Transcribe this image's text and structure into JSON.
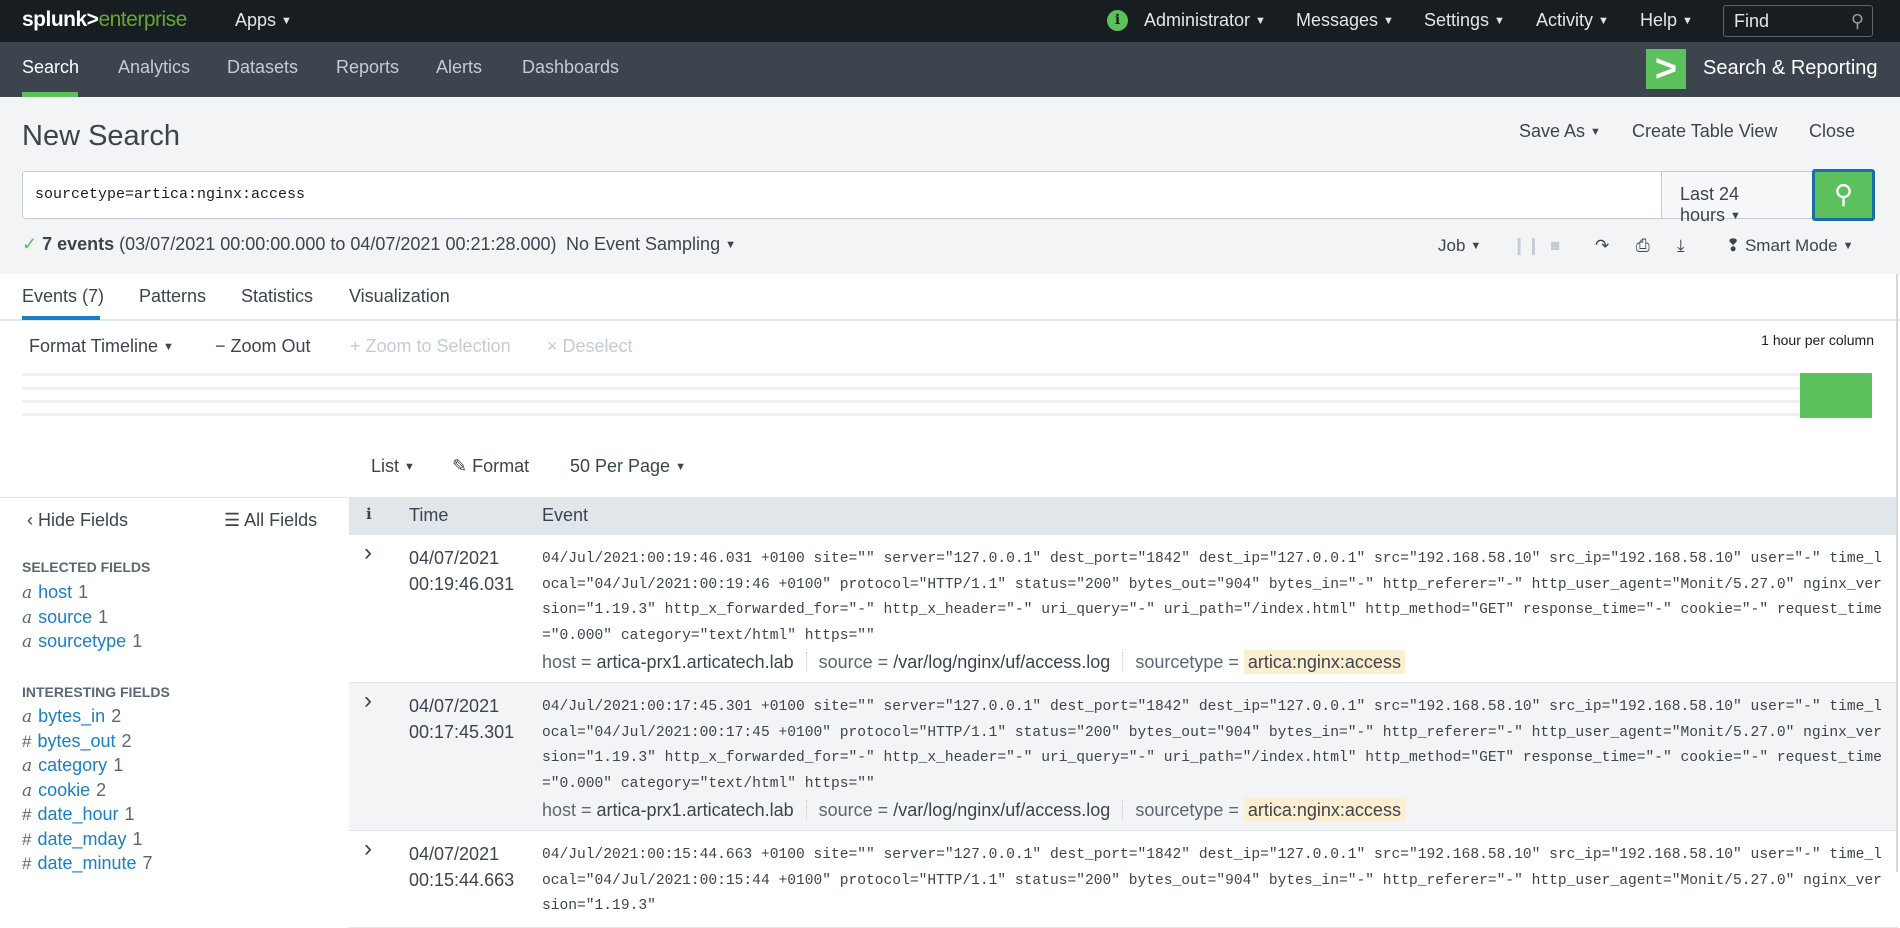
{
  "topbar": {
    "logo_a": "splunk>",
    "logo_b": "enterprise",
    "apps": "Apps",
    "info_icon": "i",
    "menus": [
      "Administrator",
      "Messages",
      "Settings",
      "Activity",
      "Help"
    ],
    "find_placeholder": "Find"
  },
  "nav": {
    "items": [
      "Search",
      "Analytics",
      "Datasets",
      "Reports",
      "Alerts",
      "Dashboards"
    ],
    "app_name": "Search & Reporting"
  },
  "header": {
    "title": "New Search",
    "save_as": "Save As",
    "create_table_view": "Create Table View",
    "close": "Close"
  },
  "search": {
    "query": "sourcetype=artica:nginx:access",
    "time_range": "Last 24 hours"
  },
  "status": {
    "count": "7 events",
    "range": "(03/07/2021 00:00:00.000 to 04/07/2021 00:21:28.000)",
    "sampling": "No Event Sampling",
    "job": "Job",
    "mode": "Smart Mode"
  },
  "tabs": [
    "Events (7)",
    "Patterns",
    "Statistics",
    "Visualization"
  ],
  "timeline": {
    "format": "Format Timeline",
    "zoom_out": "Zoom Out",
    "zoom_sel": "Zoom to Selection",
    "deselect": "Deselect",
    "resolution": "1 hour per column"
  },
  "results_bar": {
    "list": "List",
    "format": "Format",
    "per_page": "50 Per Page"
  },
  "sidebar": {
    "hide": "Hide Fields",
    "all": "All Fields",
    "selected_header": "SELECTED FIELDS",
    "interesting_header": "INTERESTING FIELDS",
    "selected": [
      {
        "type": "a",
        "name": "host",
        "count": "1"
      },
      {
        "type": "a",
        "name": "source",
        "count": "1"
      },
      {
        "type": "a",
        "name": "sourcetype",
        "count": "1"
      }
    ],
    "interesting": [
      {
        "type": "a",
        "name": "bytes_in",
        "count": "2"
      },
      {
        "type": "#",
        "name": "bytes_out",
        "count": "2"
      },
      {
        "type": "a",
        "name": "category",
        "count": "1"
      },
      {
        "type": "a",
        "name": "cookie",
        "count": "2"
      },
      {
        "type": "#",
        "name": "date_hour",
        "count": "1"
      },
      {
        "type": "#",
        "name": "date_mday",
        "count": "1"
      },
      {
        "type": "#",
        "name": "date_minute",
        "count": "7"
      }
    ]
  },
  "table": {
    "col_i": "i",
    "col_time": "Time",
    "col_event": "Event",
    "events": [
      {
        "date": "04/07/2021",
        "time": "00:19:46.031",
        "raw": "04/Jul/2021:00:19:46.031 +0100  site=\"\" server=\"127.0.0.1\" dest_port=\"1842\" dest_ip=\"127.0.0.1\" src=\"192.168.58.10\" src_ip=\"192.168.58.10\" user=\"-\" time_local=\"04/Jul/2021:00:19:46 +0100\" protocol=\"HTTP/1.1\" status=\"200\" bytes_out=\"904\" bytes_in=\"-\" http_referer=\"-\" http_user_agent=\"Monit/5.27.0\" nginx_version=\"1.19.3\" http_x_forwarded_for=\"-\" http_x_header=\"-\" uri_query=\"-\" uri_path=\"/index.html\" http_method=\"GET\" response_time=\"-\" cookie=\"-\" request_time=\"0.000\" category=\"text/html\" https=\"\"",
        "host": "artica-prx1.articatech.lab",
        "source": "/var/log/nginx/uf/access.log",
        "sourcetype": "artica:nginx:access"
      },
      {
        "date": "04/07/2021",
        "time": "00:17:45.301",
        "raw": "04/Jul/2021:00:17:45.301 +0100  site=\"\" server=\"127.0.0.1\" dest_port=\"1842\" dest_ip=\"127.0.0.1\" src=\"192.168.58.10\" src_ip=\"192.168.58.10\" user=\"-\" time_local=\"04/Jul/2021:00:17:45 +0100\" protocol=\"HTTP/1.1\" status=\"200\" bytes_out=\"904\" bytes_in=\"-\" http_referer=\"-\" http_user_agent=\"Monit/5.27.0\" nginx_version=\"1.19.3\" http_x_forwarded_for=\"-\" http_x_header=\"-\" uri_query=\"-\" uri_path=\"/index.html\" http_method=\"GET\" response_time=\"-\" cookie=\"-\" request_time=\"0.000\" category=\"text/html\" https=\"\"",
        "host": "artica-prx1.articatech.lab",
        "source": "/var/log/nginx/uf/access.log",
        "sourcetype": "artica:nginx:access"
      },
      {
        "date": "04/07/2021",
        "time": "00:15:44.663",
        "raw": "04/Jul/2021:00:15:44.663 +0100  site=\"\" server=\"127.0.0.1\" dest_port=\"1842\" dest_ip=\"127.0.0.1\" src=\"192.168.58.10\" src_ip=\"192.168.58.10\" user=\"-\" time_local=\"04/Jul/2021:00:15:44 +0100\" protocol=\"HTTP/1.1\" status=\"200\" bytes_out=\"904\" bytes_in=\"-\" http_referer=\"-\" http_user_agent=\"Monit/5.27.0\" nginx_version=\"1.19.3\"",
        "host": "",
        "source": "",
        "sourcetype": ""
      }
    ],
    "meta_labels": {
      "host": "host = ",
      "source": "source = ",
      "sourcetype": "sourcetype = "
    }
  }
}
